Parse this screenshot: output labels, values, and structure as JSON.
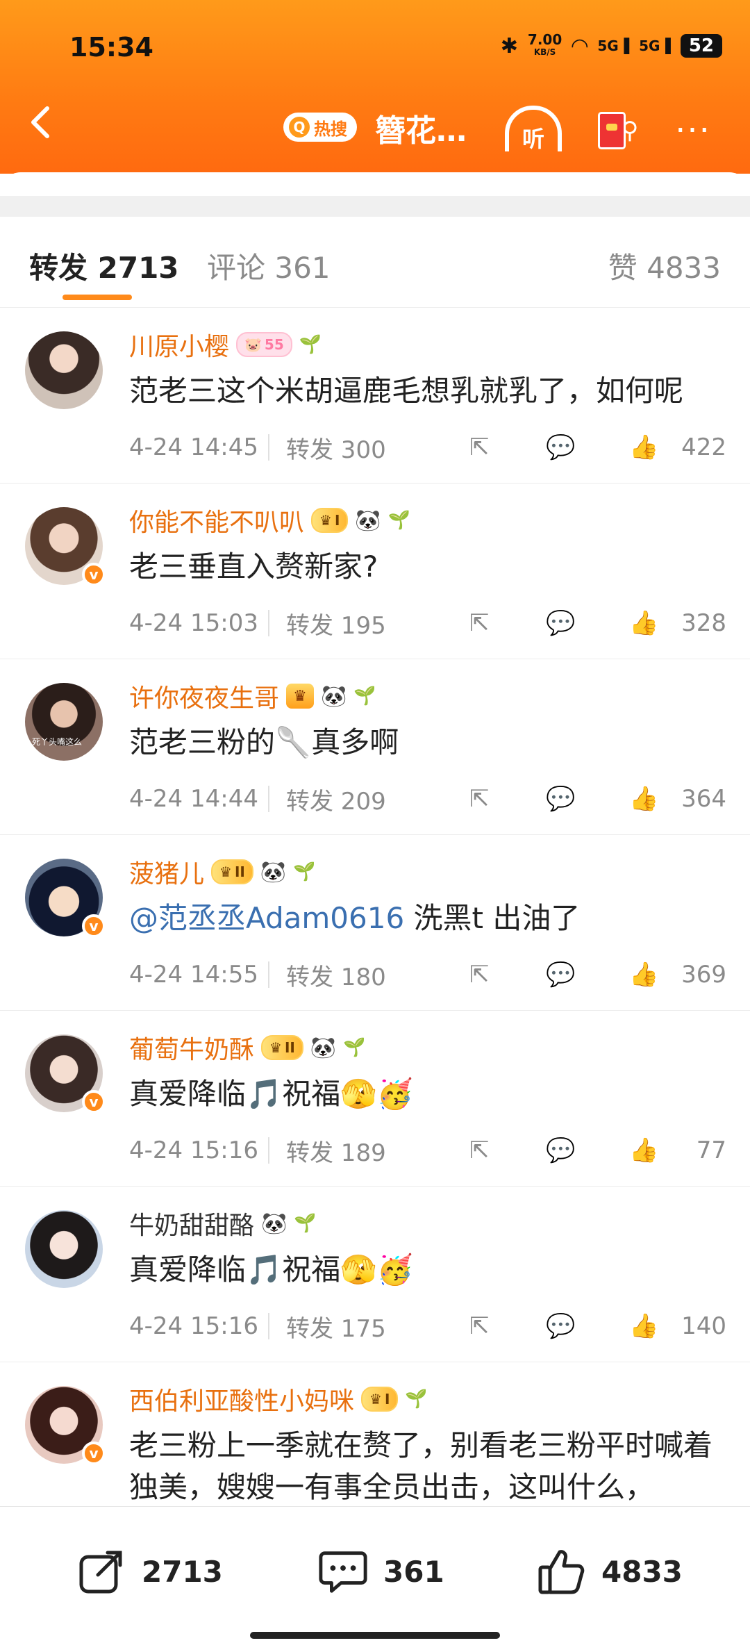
{
  "status": {
    "time": "15:34",
    "speed": "7.00",
    "speed_unit": "KB/S",
    "net1": "5G",
    "net2": "5G",
    "battery": "52"
  },
  "navbar": {
    "hot_label": "热搜",
    "topic": "簪花…",
    "listen_label": "听"
  },
  "tabs": {
    "repost": "转发 2713",
    "comment": "评论 361",
    "like": "赞 4833"
  },
  "comments": [
    {
      "name": "川原小樱",
      "badge": "55",
      "content": "范老三这个米胡逼鹿毛想乳就乳了，如何呢",
      "date": "4-24 14:45",
      "repost": "转发 300",
      "likes": "422"
    },
    {
      "name": "你能不能不叭叭",
      "badge": "I",
      "content": "老三垂直入赘新家?",
      "date": "4-24 15:03",
      "repost": "转发 195",
      "likes": "328"
    },
    {
      "name": "许你夜夜生哥",
      "avatar_caption": "死丫头嘴这么",
      "content": "范老三粉的🥄真多啊",
      "date": "4-24 14:44",
      "repost": "转发 209",
      "likes": "364"
    },
    {
      "name": "菠猪儿",
      "badge": "II",
      "mention": "@范丞丞Adam0616",
      "content": " 洗黑t 出油了",
      "date": "4-24 14:55",
      "repost": "转发 180",
      "likes": "369"
    },
    {
      "name": "葡萄牛奶酥",
      "badge": "II",
      "content": "真爱降临🎵祝福🫣🥳",
      "date": "4-24 15:16",
      "repost": "转发 189",
      "likes": "77"
    },
    {
      "name": "牛奶甜甜酪",
      "content": "真爱降临🎵祝福🫣🥳",
      "date": "4-24 15:16",
      "repost": "转发 175",
      "likes": "140"
    },
    {
      "name": "西伯利亚酸性小妈咪",
      "badge": "I",
      "content": "老三粉上一季就在赘了，别看老三粉平时喊着独美，嫂嫂一有事全员出击，这叫什么，"
    }
  ],
  "bottom": {
    "repost": "2713",
    "comment": "361",
    "like": "4833"
  },
  "colors": {
    "accent": "#ff8a1a",
    "username": "#e8700f"
  },
  "icons": [
    "back-arrow-icon",
    "hot-search-icon",
    "headphones-icon",
    "red-packet-search-icon",
    "more-icon",
    "share-icon",
    "comment-icon",
    "like-icon",
    "panda-icon",
    "sprout-icon",
    "crown-icon",
    "verified-icon"
  ]
}
